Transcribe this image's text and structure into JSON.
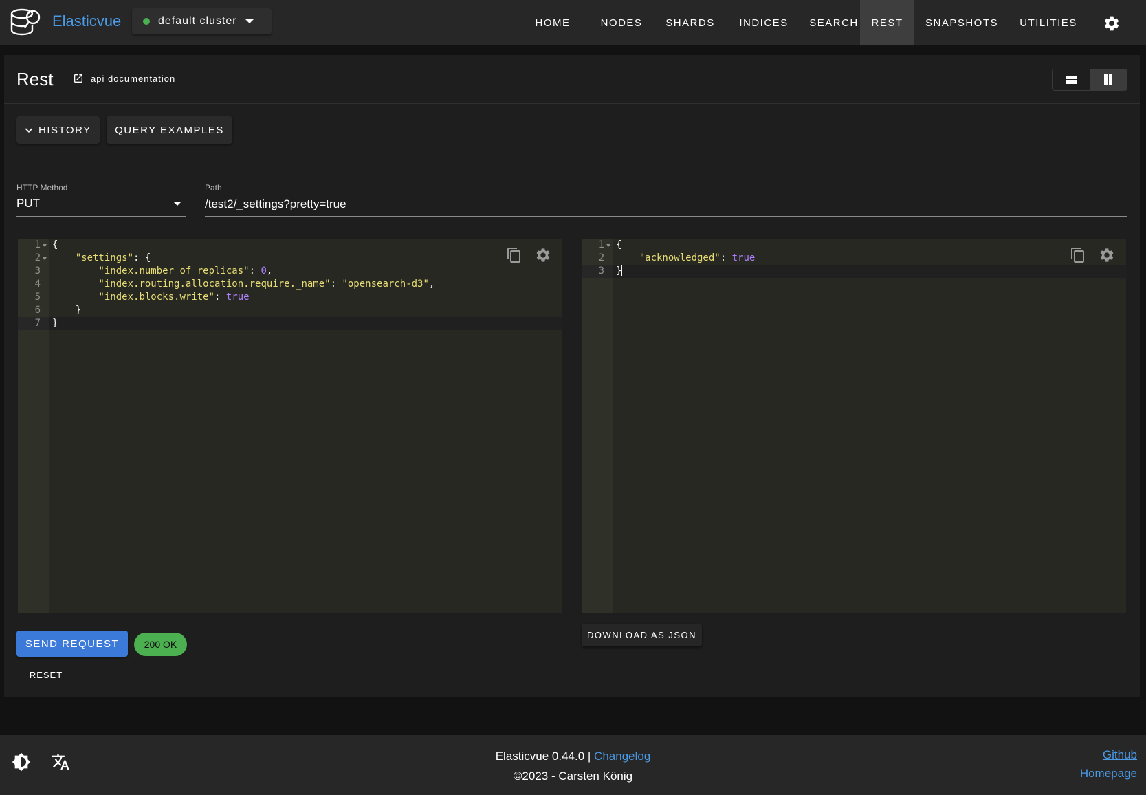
{
  "app": {
    "brand": "Elasticvue",
    "cluster": {
      "name": "default cluster",
      "status_color": "#4caf50"
    },
    "accent_color": "#4a9ae6"
  },
  "nav": {
    "items": [
      {
        "label": "HOME",
        "active": false
      },
      {
        "label": "NODES",
        "active": false
      },
      {
        "label": "SHARDS",
        "active": false
      },
      {
        "label": "INDICES",
        "active": false
      },
      {
        "label": "SEARCH",
        "active": false
      },
      {
        "label": "REST",
        "active": true
      },
      {
        "label": "SNAPSHOTS",
        "active": false
      },
      {
        "label": "UTILITIES",
        "active": false
      }
    ],
    "settings_icon": "gear-icon"
  },
  "page": {
    "title": "Rest",
    "doc_link": "api documentation",
    "history_button": "HISTORY",
    "examples_button": "QUERY EXAMPLES",
    "method_label": "HTTP Method",
    "method_value": "PUT",
    "path_label": "Path",
    "path_value": "/test2/_settings?pretty=true",
    "send_button": "SEND REQUEST",
    "status": "200 OK",
    "status_color": "#4caf50",
    "reset_button": "RESET",
    "download_button": "DOWNLOAD AS JSON"
  },
  "request_editor": {
    "lines": [
      [
        "1",
        "{"
      ],
      [
        "2",
        "    \"settings\": {"
      ],
      [
        "3",
        "        \"index.number_of_replicas\": 0,"
      ],
      [
        "4",
        "        \"index.routing.allocation.require._name\": \"opensearch-d3\","
      ],
      [
        "5",
        "        \"index.blocks.write\": true"
      ],
      [
        "6",
        "    }"
      ],
      [
        "7",
        "}"
      ]
    ]
  },
  "response_editor": {
    "lines": [
      [
        "1",
        "{"
      ],
      [
        "2",
        "    \"acknowledged\": true"
      ],
      [
        "3",
        "}"
      ]
    ]
  },
  "footer": {
    "version": "Elasticvue 0.44.0 |",
    "changelog": "Changelog",
    "copyright": "©2023 - Carsten König",
    "github": "Github",
    "homepage": "Homepage"
  }
}
